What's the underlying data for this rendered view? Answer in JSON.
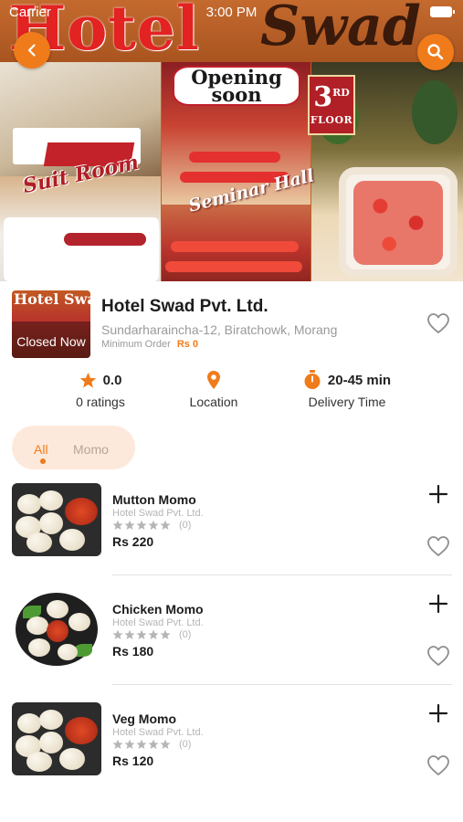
{
  "status_bar": {
    "carrier": "Carrier",
    "time": "3:00 PM"
  },
  "banner": {
    "title_left": "Hotel",
    "title_right": "Swad",
    "opening_sign": "Opening soon",
    "floor_number": "3",
    "floor_suffix": "RD",
    "floor_word": "FLOOR",
    "caption_suite": "Suit Room",
    "caption_hall": "Seminar Hall"
  },
  "icons": {
    "back": "back-arrow-icon",
    "search": "search-icon",
    "favorite": "heart-outline-icon",
    "add": "plus-icon",
    "star": "star-icon",
    "location": "location-pin-icon",
    "time": "timer-icon"
  },
  "colors": {
    "accent": "#f07b1a",
    "accent_light": "#fde9db",
    "text": "#1c1c1c",
    "muted": "#9a9a9a",
    "star_empty": "#b5b5b5"
  },
  "store": {
    "thumb_text": "Hotel Swad",
    "status": "Closed Now",
    "name": "Hotel Swad Pvt. Ltd.",
    "address": "Sundarharaincha-12, Biratchowk, Morang",
    "min_order_label": "Minimum Order",
    "min_order_value": "Rs 0"
  },
  "stats": {
    "rating_value": "0.0",
    "rating_label": "0 ratings",
    "location_label": "Location",
    "time_value": "20-45 min",
    "time_label": "Delivery Time"
  },
  "tabs": [
    {
      "label": "All",
      "active": true
    },
    {
      "label": "Momo",
      "active": false
    }
  ],
  "items": [
    {
      "name": "Mutton Momo",
      "restaurant": "Hotel Swad Pvt. Ltd.",
      "rating": 0,
      "rating_count": "(0)",
      "price": "Rs 220"
    },
    {
      "name": "Chicken Momo",
      "restaurant": "Hotel Swad Pvt. Ltd.",
      "rating": 0,
      "rating_count": "(0)",
      "price": "Rs 180"
    },
    {
      "name": "Veg Momo",
      "restaurant": "Hotel Swad Pvt. Ltd.",
      "rating": 0,
      "rating_count": "(0)",
      "price": "Rs 120"
    }
  ]
}
